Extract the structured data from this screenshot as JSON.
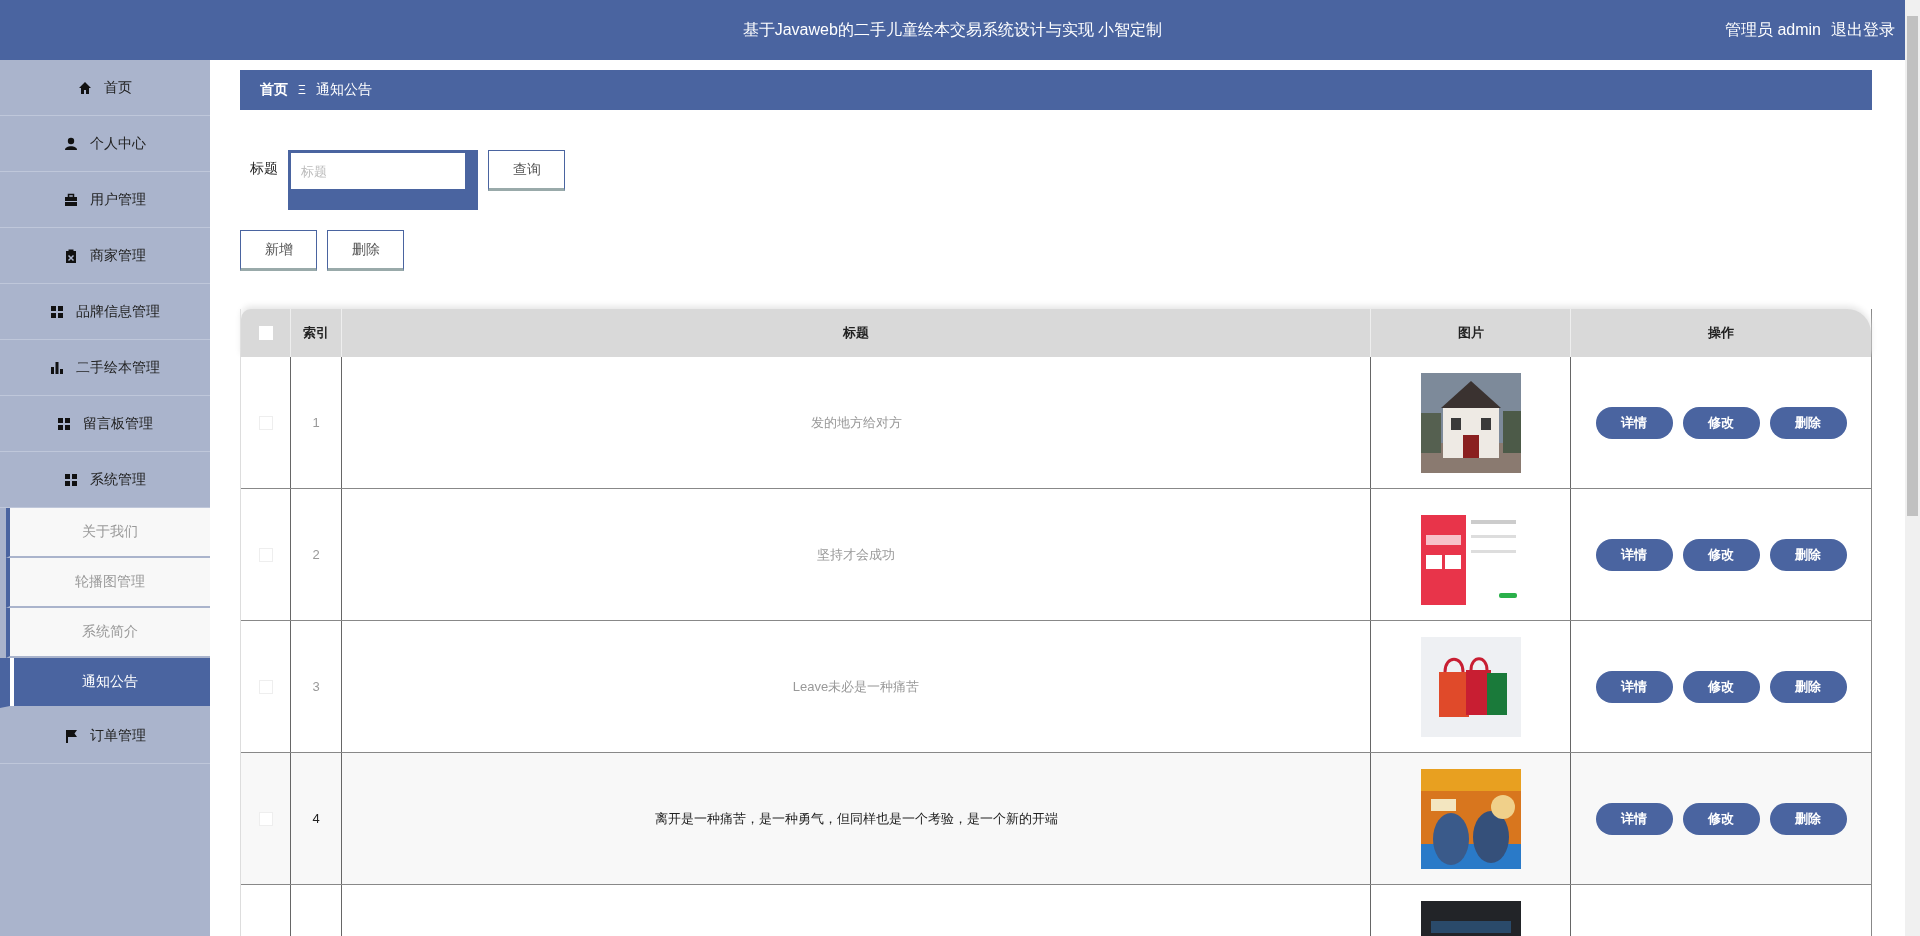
{
  "header": {
    "title": "基于Javaweb的二手儿童绘本交易系统设计与实现 小智定制",
    "user": "管理员 admin",
    "logout": "退出登录"
  },
  "sidebar": {
    "items": [
      {
        "label": "首页",
        "selected": false
      },
      {
        "label": "个人中心",
        "selected": false
      },
      {
        "label": "用户管理",
        "selected": false
      },
      {
        "label": "商家管理",
        "selected": false
      },
      {
        "label": "品牌信息管理",
        "selected": false
      },
      {
        "label": "二手绘本管理",
        "selected": false
      },
      {
        "label": "留言板管理",
        "selected": false
      },
      {
        "label": "系统管理",
        "selected": false,
        "expanded": true,
        "children": [
          {
            "label": "关于我们",
            "selected": false
          },
          {
            "label": "轮播图管理",
            "selected": false
          },
          {
            "label": "系统简介",
            "selected": false
          },
          {
            "label": "通知公告",
            "selected": true
          }
        ]
      },
      {
        "label": "订单管理",
        "selected": false
      }
    ]
  },
  "breadcrumb": {
    "home": "首页",
    "separator": "Ξ",
    "current": "通知公告"
  },
  "search": {
    "label": "标题",
    "placeholder": "标题",
    "button": "查询"
  },
  "toolbar": [
    "新增",
    "删除"
  ],
  "table": {
    "columns": [
      "索引",
      "标题",
      "图片",
      "操作"
    ],
    "header_checked": false,
    "rows": [
      {
        "index": "1",
        "title": "发的地方给对方",
        "checked": false,
        "hovered": false,
        "picture": {
          "kind": "picture"
        },
        "actions": [
          "详情",
          "修改",
          "删除"
        ]
      },
      {
        "index": "2",
        "title": "坚持才会成功",
        "checked": false,
        "hovered": false,
        "picture": {
          "kind": "picture"
        },
        "actions": [
          "详情",
          "修改",
          "删除"
        ]
      },
      {
        "index": "3",
        "title": "Leave未必是一种痛苦",
        "checked": false,
        "hovered": false,
        "picture": {
          "kind": "picture"
        },
        "actions": [
          "详情",
          "修改",
          "删除"
        ]
      },
      {
        "index": "4",
        "title": "离开是一种痛苦，是一种勇气，但同样也是一个考验，是一个新的开端",
        "checked": false,
        "hovered": true,
        "picture": {
          "kind": "picture"
        },
        "actions": [
          "详情",
          "修改",
          "删除"
        ]
      },
      {
        "picture": {
          "kind": "picture"
        }
      }
    ]
  }
}
